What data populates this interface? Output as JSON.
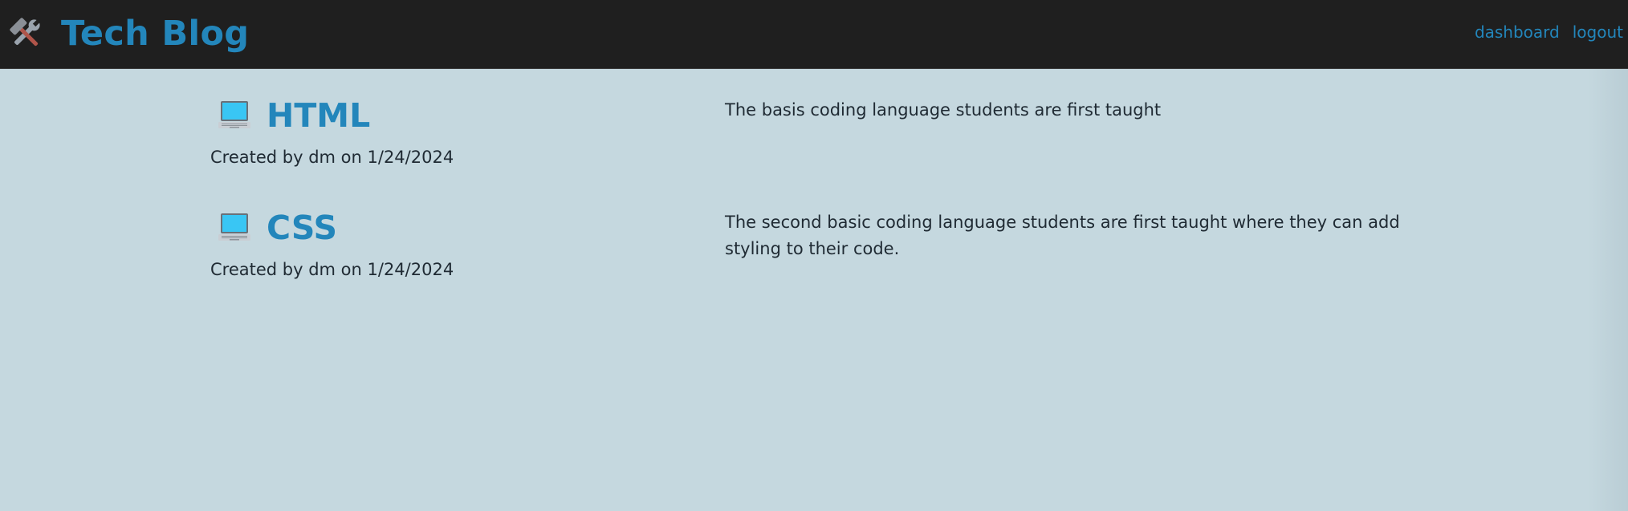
{
  "header": {
    "brand_icon": "hammer-and-wrench-icon",
    "title": "Tech Blog",
    "nav": {
      "dashboard_label": "dashboard",
      "logout_label": "logout"
    }
  },
  "posts": [
    {
      "icon": "laptop-icon",
      "title": "HTML",
      "meta": "Created by dm on 1/24/2024",
      "description": "The basis coding language students are first taught"
    },
    {
      "icon": "laptop-icon",
      "title": "CSS",
      "meta": "Created by dm on 1/24/2024",
      "description": "The second basic coding language students are first taught where they can add styling to their code."
    }
  ],
  "colors": {
    "background": "#c5d8df",
    "header_bg": "#1f1f1f",
    "accent": "#2386bb",
    "text": "#1f2a33"
  }
}
